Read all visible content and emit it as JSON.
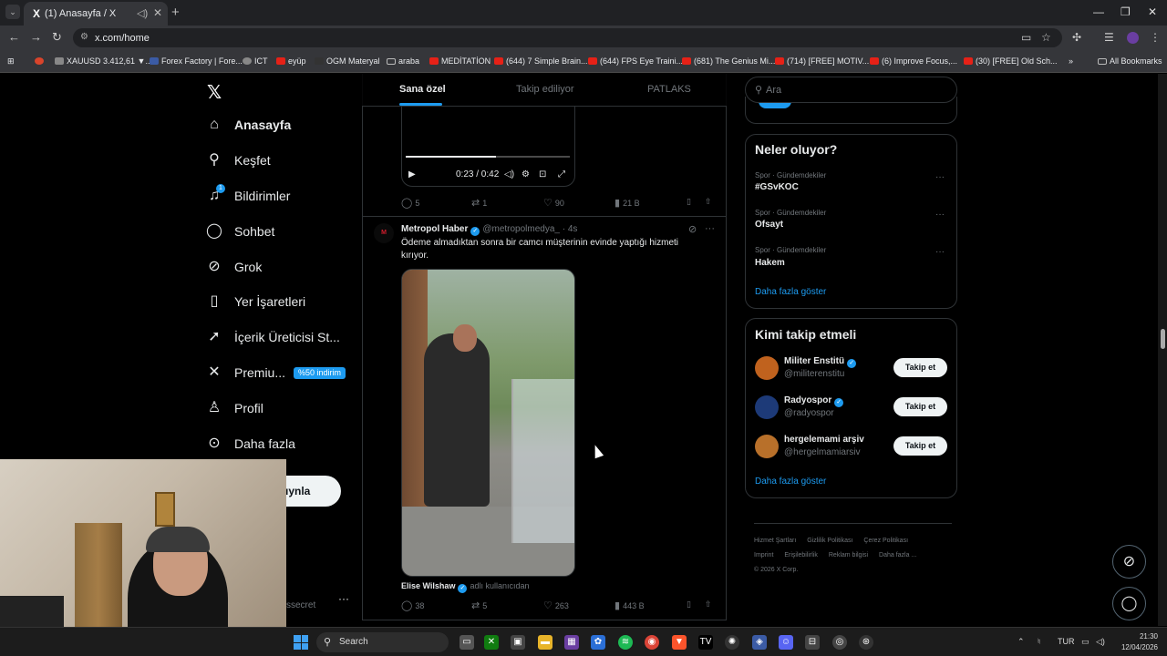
{
  "browser": {
    "tab_title": "(1) Anasayfa / X",
    "url": "x.com/home",
    "bookmarks": [
      {
        "label": "XAUUSD 3.412,61 ▼...",
        "icon": "tradingview-icon"
      },
      {
        "label": "Forex Factory | Fore...",
        "icon": "forexfactory-icon"
      },
      {
        "label": "ICT",
        "icon": "globe-icon"
      },
      {
        "label": "eyüp",
        "icon": "youtube-icon"
      },
      {
        "label": "OGM Materyal",
        "icon": "site-icon"
      },
      {
        "label": "araba",
        "icon": "folder-icon"
      },
      {
        "label": "MEDİTATİON",
        "icon": "youtube-icon"
      },
      {
        "label": "(644) 7 Simple Brain...",
        "icon": "youtube-icon"
      },
      {
        "label": "(644) FPS Eye Traini...",
        "icon": "youtube-icon"
      },
      {
        "label": "(681) The Genius Mi...",
        "icon": "youtube-icon"
      },
      {
        "label": "(714) [FREE] MOTIV...",
        "icon": "youtube-icon"
      },
      {
        "label": "(6) Improve Focus,...",
        "icon": "youtube-icon"
      },
      {
        "label": "(30) [FREE] Old Sch...",
        "icon": "youtube-icon"
      }
    ],
    "all_bookmarks": "All Bookmarks"
  },
  "sidebar": {
    "items": [
      {
        "label": "Anasayfa",
        "icon": "home-icon"
      },
      {
        "label": "Keşfet",
        "icon": "search-icon"
      },
      {
        "label": "Bildirimler",
        "icon": "bell-icon",
        "badge": "1"
      },
      {
        "label": "Sohbet",
        "icon": "chat-icon"
      },
      {
        "label": "Grok",
        "icon": "grok-icon"
      },
      {
        "label": "Yer İşaretleri",
        "icon": "bookmark-icon"
      },
      {
        "label": "İçerik Üreticisi St...",
        "icon": "rocket-icon"
      },
      {
        "label": "Premiu...",
        "icon": "x-icon",
        "discount": "%50 indirim"
      },
      {
        "label": "Profil",
        "icon": "person-icon"
      },
      {
        "label": "Daha fazla",
        "icon": "more-circle-icon"
      }
    ],
    "post_button": "ıynla",
    "account_handle": "ssecret"
  },
  "feed": {
    "tabs": [
      "Sana özel",
      "Takip ediliyor",
      "PATLAKS"
    ],
    "video_time": "0:23 / 0:42",
    "video_progress": 0.55,
    "tweet1_stats": {
      "replies": "5",
      "retweets": "1",
      "likes": "90",
      "views": "21 B"
    },
    "tweet2": {
      "name": "Metropol Haber",
      "handle": "@metropolmedya_",
      "time": "· 4s",
      "avatar_text": "M",
      "text": "Ödeme almadıktan sonra bir camcı müşterinin evinde yaptığı hizmeti kırıyor.",
      "tagged_name": "Elise Wilshaw",
      "tagged_sub": "adlı kullanıcıdan",
      "stats": {
        "replies": "38",
        "retweets": "5",
        "likes": "263",
        "views": "443 B"
      }
    }
  },
  "right": {
    "search_placeholder": "Ara",
    "trends_title": "Neler oluyor?",
    "trends": [
      {
        "meta": "Spor · Gündemdekiler",
        "name": "#GSvKOC"
      },
      {
        "meta": "Spor · Gündemdekiler",
        "name": "Ofsayt"
      },
      {
        "meta": "Spor · Gündemdekiler",
        "name": "Hakem"
      }
    ],
    "show_more": "Daha fazla göster",
    "wtf_title": "Kimi takip etmeli",
    "wtf": [
      {
        "name": "Militer Enstitü",
        "handle": "@militerenstitu",
        "color": "#c0621e"
      },
      {
        "name": "Radyospor",
        "handle": "@radyospor",
        "color": "#1d3a78"
      },
      {
        "name": "hergelemami arşiv",
        "handle": "@hergelmamiarsiv",
        "color": "#b8702a"
      }
    ],
    "follow_label": "Takip et",
    "footer": [
      "Hizmet Şartları",
      "Gizlilik Politikası",
      "Çerez Politikası",
      "Imprint",
      "Erişilebilirlik",
      "Reklam bilgisi",
      "Daha fazla ...",
      "© 2026 X Corp."
    ]
  },
  "taskbar": {
    "search": "Search",
    "lang": "TUR",
    "time": "21:30",
    "date": "12/04/2026"
  },
  "colors": {
    "accent": "#1d9bf0",
    "background": "#000000"
  }
}
